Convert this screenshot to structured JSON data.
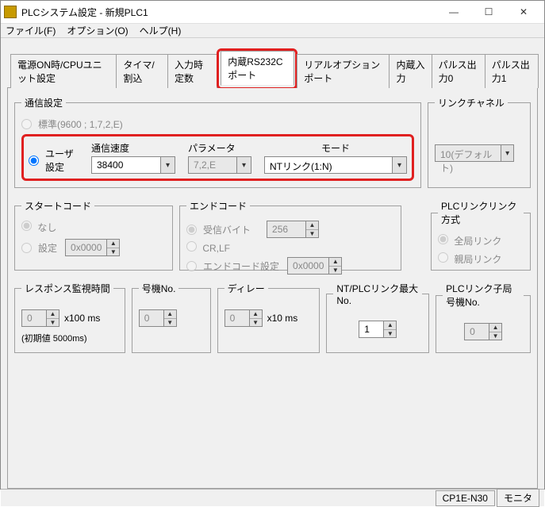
{
  "window": {
    "title": "PLCシステム設定 - 新規PLC1"
  },
  "menu": {
    "file": "ファイル(F)",
    "options": "オプション(O)",
    "help": "ヘルプ(H)"
  },
  "tabs": {
    "t0": "電源ON時/CPUユニット設定",
    "t1": "タイマ/割込",
    "t2": "入力時定数",
    "t3": "内蔵RS232Cポート",
    "t4": "リアルオプションポート",
    "t5": "内蔵入力",
    "t6": "パルス出力0",
    "t7": "パルス出力1"
  },
  "commset": {
    "legend": "通信設定",
    "radio_std": "標準(9600 ; 1,7,2,E)",
    "radio_user": "ユーザ設定",
    "speed_lbl": "通信速度",
    "speed_val": "38400",
    "param_lbl": "パラメータ",
    "param_val": "7,2,E",
    "mode_lbl": "モード",
    "mode_val": "NTリンク(1:N)"
  },
  "linkch": {
    "legend": "リンクチャネル",
    "val": "10(デフォルト)"
  },
  "startcode": {
    "legend": "スタートコード",
    "none": "なし",
    "set": "設定",
    "val": "0x0000"
  },
  "endcode": {
    "legend": "エンドコード",
    "recv": "受信バイト",
    "recv_val": "256",
    "crlf": "CR,LF",
    "set": "エンドコード設定",
    "set_val": "0x0000"
  },
  "plclink": {
    "legend": "PLCリンクリンク方式",
    "all": "全局リンク",
    "master": "親局リンク"
  },
  "resp": {
    "legend": "レスポンス監視時間",
    "val": "0",
    "unit": "x100 ms",
    "note": "(初期値 5000ms)"
  },
  "unitno": {
    "legend": "号機No.",
    "val": "0"
  },
  "delay": {
    "legend": "ディレー",
    "val": "0",
    "unit": "x10 ms"
  },
  "ntplc": {
    "legend": "NT/PLCリンク最大No.",
    "val": "1"
  },
  "plcslave": {
    "legend": "PLCリンク子局号機No.",
    "val": "0"
  },
  "status": {
    "model": "CP1E-N30",
    "mode": "モニタ"
  }
}
